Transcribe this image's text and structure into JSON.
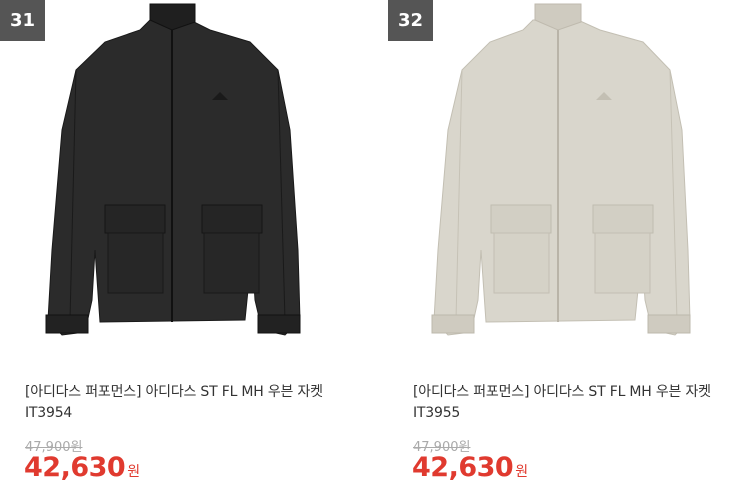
{
  "products": [
    {
      "rank": "31",
      "title": "[아디다스 퍼포먼스] 아디다스 ST FL MH 우븐 자켓 IT3954",
      "original_price": "47,900원",
      "sale_price": "42,630",
      "currency": "원",
      "jacket_color": "#2b2b2b"
    },
    {
      "rank": "32",
      "title": "[아디다스 퍼포먼스] 아디다스 ST FL MH 우븐 자켓 IT3955",
      "original_price": "47,900원",
      "sale_price": "42,630",
      "currency": "원",
      "jacket_color": "#d9d6cc"
    }
  ],
  "colors": {
    "rank_badge": "#555555",
    "sale_price": "#e03a2f",
    "original_price": "#aaaaaa",
    "title": "#333333"
  }
}
